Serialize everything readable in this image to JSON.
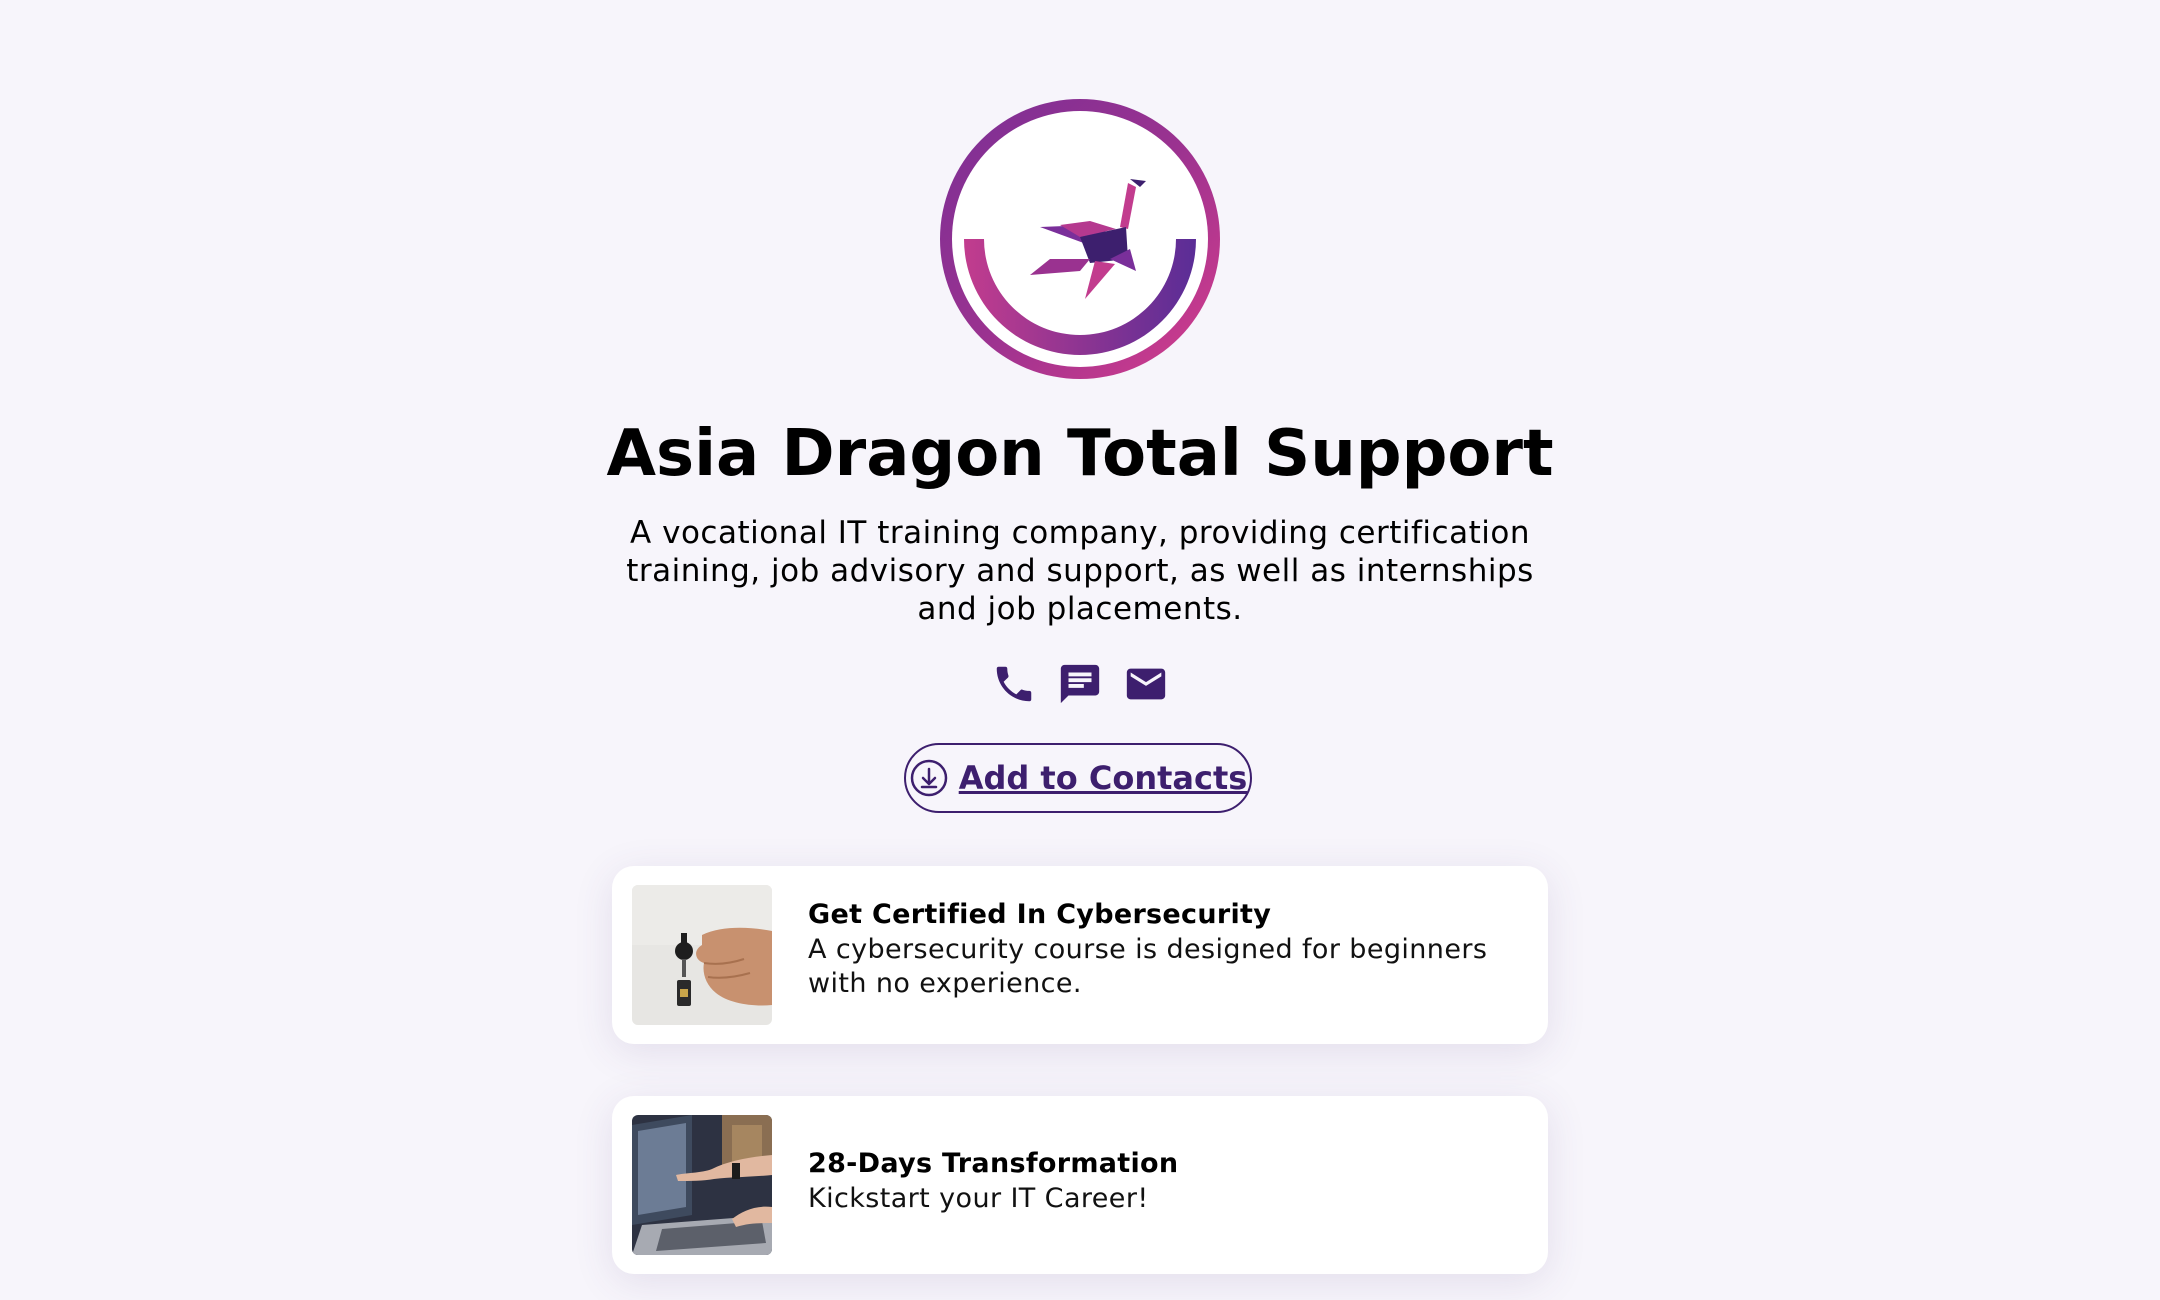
{
  "profile": {
    "name": "Asia Dragon Total Support",
    "bio": "A vocational IT training company, providing certification training, job advisory and support, as well as internships and job placements.",
    "avatar_icon": "dragon-logo"
  },
  "contact_icons": [
    {
      "name": "phone-icon"
    },
    {
      "name": "message-icon"
    },
    {
      "name": "email-icon"
    }
  ],
  "add_contacts": {
    "label": "Add to Contacts",
    "icon": "download-icon"
  },
  "cards": [
    {
      "title": "Get Certified In Cybersecurity",
      "description": "A cybersecurity course is designed for beginners with no experience.",
      "thumbnail": "hand-holding-key"
    },
    {
      "title": "28-Days Transformation",
      "description": "Kickstart your IT Career!",
      "thumbnail": "hands-on-laptop"
    }
  ],
  "colors": {
    "accent": "#3d1f6e",
    "background": "#f7f5fb",
    "logo_gradient_start": "#8e2d8f",
    "logo_gradient_end": "#d63d8c"
  }
}
